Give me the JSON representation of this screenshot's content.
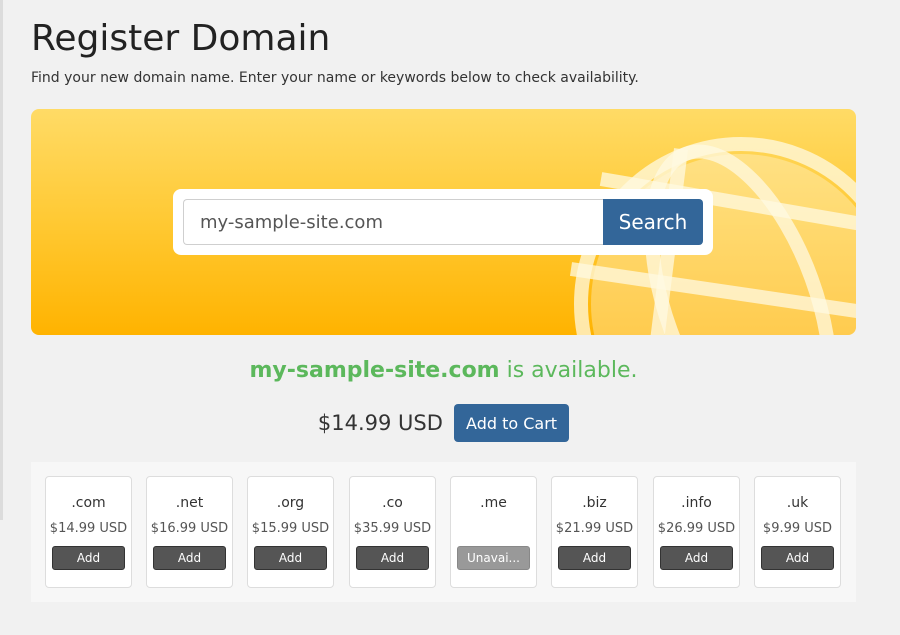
{
  "header": {
    "title": "Register Domain",
    "subtitle": "Find your new domain name. Enter your name or keywords below to check availability."
  },
  "search": {
    "value": "my-sample-site.com",
    "button_label": "Search"
  },
  "result": {
    "domain": "my-sample-site.com",
    "status_text": " is available.",
    "price": "$14.99 USD",
    "add_to_cart_label": "Add to Cart"
  },
  "colors": {
    "accent": "#336699",
    "available_text": "#5cb85c",
    "banner_yellow": "#ffc933",
    "tld_button": "#555555",
    "tld_button_unavailable": "#999999"
  },
  "tlds": [
    {
      "name": ".com",
      "price": "$14.99 USD",
      "button": "Add"
    },
    {
      "name": ".net",
      "price": "$16.99 USD",
      "button": "Add"
    },
    {
      "name": ".org",
      "price": "$15.99 USD",
      "button": "Add"
    },
    {
      "name": ".co",
      "price": "$35.99 USD",
      "button": "Add"
    },
    {
      "name": ".me",
      "price": "",
      "button": "Unavai..."
    },
    {
      "name": ".biz",
      "price": "$21.99 USD",
      "button": "Add"
    },
    {
      "name": ".info",
      "price": "$26.99 USD",
      "button": "Add"
    },
    {
      "name": ".uk",
      "price": "$9.99 USD",
      "button": "Add"
    }
  ]
}
